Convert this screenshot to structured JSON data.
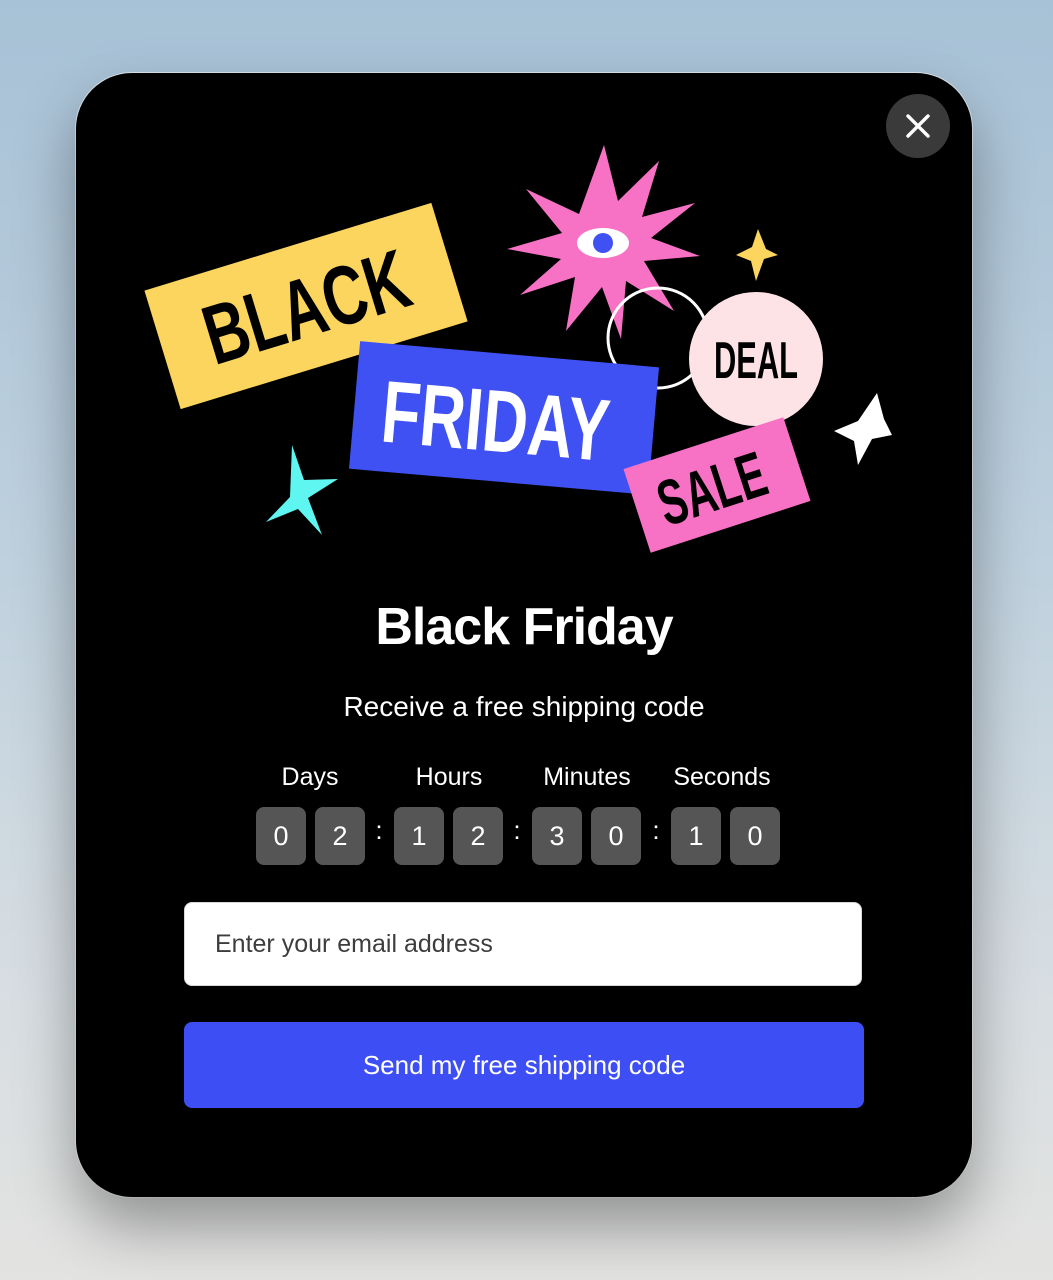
{
  "modal": {
    "close_icon": "close-icon",
    "illustration": {
      "black_label": "BLACK",
      "friday_label": "FRIDAY",
      "deal_label": "DEAL",
      "sale_label": "SALE",
      "colors": {
        "yellow": "#fcd55f",
        "blue": "#3f51f2",
        "pink": "#f772c4",
        "deal_bg": "#fde3e6",
        "cyan": "#5ff5f0",
        "white": "#ffffff"
      }
    },
    "title": "Black Friday",
    "subtitle": "Receive a free shipping code",
    "countdown": {
      "labels": [
        "Days",
        "Hours",
        "Minutes",
        "Seconds"
      ],
      "days": [
        "0",
        "2"
      ],
      "hours": [
        "1",
        "2"
      ],
      "minutes": [
        "3",
        "0"
      ],
      "seconds": [
        "1",
        "0"
      ],
      "separator": ":"
    },
    "email_placeholder": "Enter your email address",
    "submit_label": "Send my free shipping code",
    "accent_color": "#3d4ef5"
  }
}
